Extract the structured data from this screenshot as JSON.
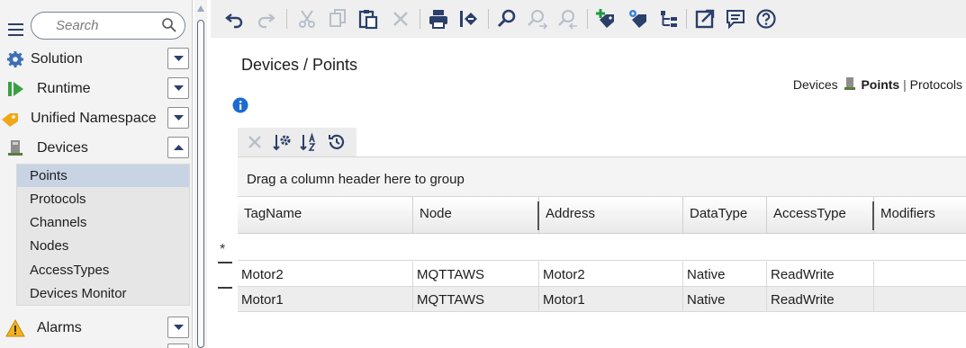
{
  "search": {
    "placeholder": "Search"
  },
  "sidebar": {
    "items": [
      {
        "label": "Solution"
      },
      {
        "label": "Runtime"
      },
      {
        "label": "Unified Namespace"
      },
      {
        "label": "Devices"
      },
      {
        "label": "Alarms"
      }
    ],
    "devices_children": [
      "Points",
      "Protocols",
      "Channels",
      "Nodes",
      "AccessTypes",
      "Devices Monitor"
    ],
    "active_child": "Points"
  },
  "toolbar": {
    "icons": [
      "undo-icon",
      "redo-icon",
      "cut-icon",
      "copy-icon",
      "paste-icon",
      "delete-icon",
      "print-icon",
      "import-icon",
      "find-icon",
      "find-next-icon",
      "find-previous-icon",
      "add-tag-icon",
      "tag-settings-icon",
      "tree-icon",
      "open-new-window-icon",
      "comment-icon",
      "help-icon"
    ]
  },
  "page": {
    "breadcrumb": "Devices / Points",
    "switcher": {
      "devices": "Devices",
      "points": "Points",
      "protocols": "Protocols",
      "divider": "|"
    }
  },
  "grid": {
    "group_hint": "Drag a column header here to group",
    "new_row_marker": "*",
    "columns": [
      "TagName",
      "Node",
      "Address",
      "DataType",
      "AccessType",
      "Modifiers"
    ],
    "rows": [
      [
        "Motor2",
        "MQTTAWS",
        "Motor2",
        "Native",
        "ReadWrite",
        ""
      ],
      [
        "Motor1",
        "MQTTAWS",
        "Motor1",
        "Native",
        "ReadWrite",
        ""
      ]
    ]
  },
  "colors": {
    "accent": "#2a3f6a",
    "selected_row": "#c8d4e3",
    "add_green": "#1f9a3c"
  }
}
